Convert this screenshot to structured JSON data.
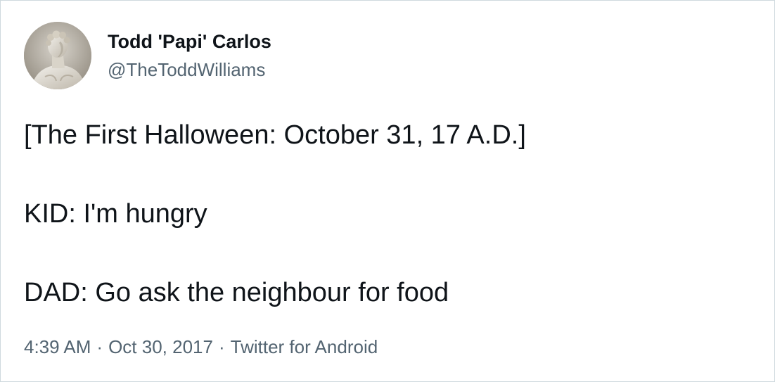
{
  "tweet": {
    "author": {
      "display_name": "Todd 'Papi' Carlos",
      "handle": "@TheToddWilliams",
      "avatar_icon": "marble-bust-avatar"
    },
    "text_lines": [
      "[The First Halloween: October 31, 17 A.D.]",
      "KID: I'm hungry",
      "DAD: Go ask the neighbour for food"
    ],
    "meta": {
      "time": "4:39 AM",
      "separator": "·",
      "date": "Oct 30, 2017",
      "source": "Twitter for Android"
    },
    "colors": {
      "primary_text": "#0f1419",
      "secondary_text": "#536471",
      "border": "#cfd9de"
    }
  }
}
